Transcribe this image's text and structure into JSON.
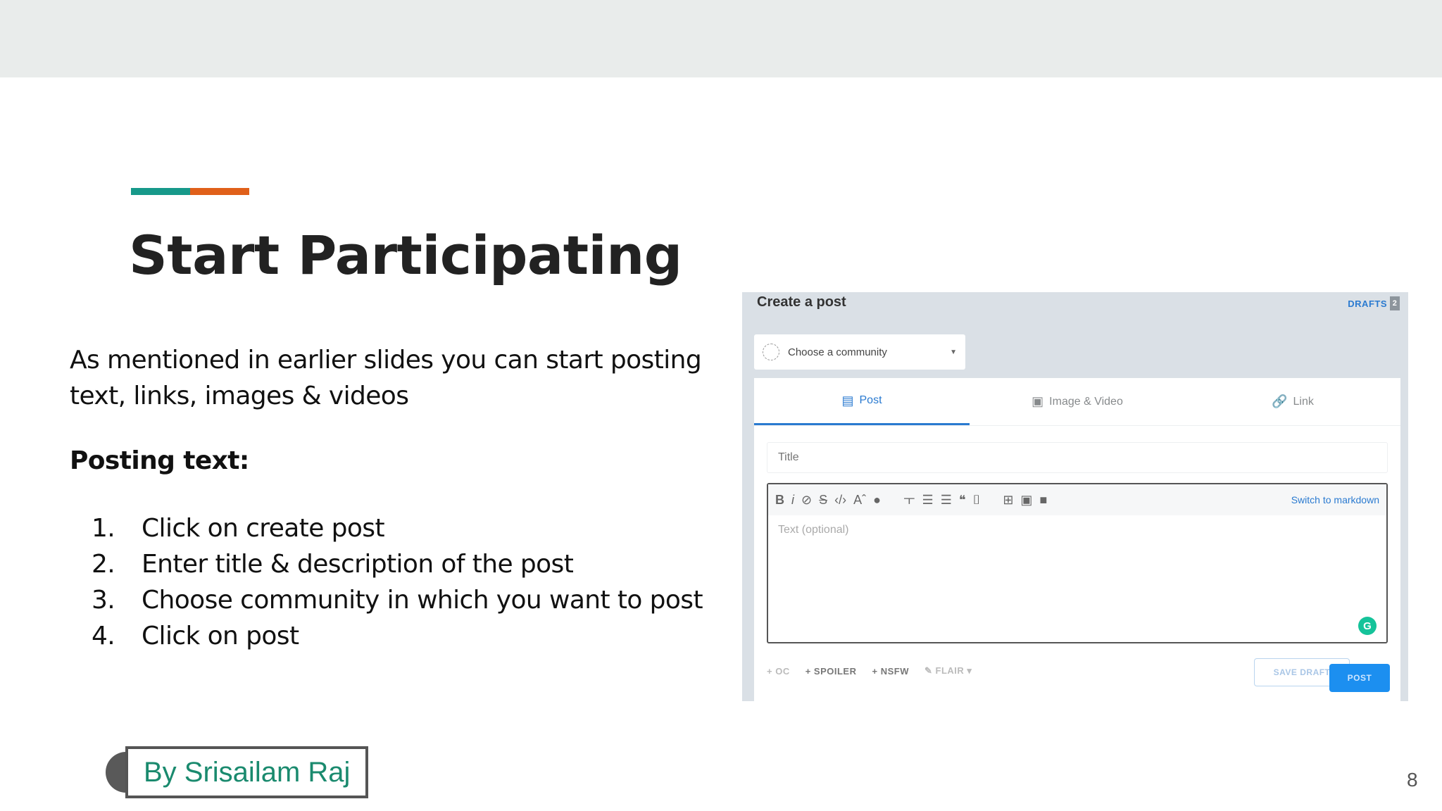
{
  "slide": {
    "title": "Start Participating",
    "intro": "As mentioned in earlier slides you can start posting text, links, images & videos",
    "subhead": "Posting text:",
    "steps": [
      {
        "num": "1.",
        "text": "Click on create post"
      },
      {
        "num": "2.",
        "text": "Enter title & description of the post"
      },
      {
        "num": "3.",
        "text": "Choose community in which you want to post"
      },
      {
        "num": "4.",
        "text": "Click on post"
      }
    ],
    "author": "By Srisailam Raj",
    "page_number": "8"
  },
  "screenshot": {
    "header": "Create a post",
    "drafts_label": "DRAFTS",
    "drafts_count": "2",
    "community_placeholder": "Choose a community",
    "tabs": [
      {
        "label": "Post",
        "icon": "post-icon"
      },
      {
        "label": "Image & Video",
        "icon": "image-icon"
      },
      {
        "label": "Link",
        "icon": "link-icon"
      }
    ],
    "title_placeholder": "Title",
    "switch_markdown": "Switch to markdown",
    "text_placeholder": "Text (optional)",
    "tags": [
      "+ OC",
      "+ SPOILER",
      "+ NSFW",
      "FLAIR"
    ],
    "save_draft": "SAVE DRAFT",
    "post": "POST"
  },
  "colors": {
    "teal": "#17998a",
    "orange": "#e0601a",
    "reddit_blue": "#2a7ad0",
    "author_text": "#1a8a6e"
  }
}
